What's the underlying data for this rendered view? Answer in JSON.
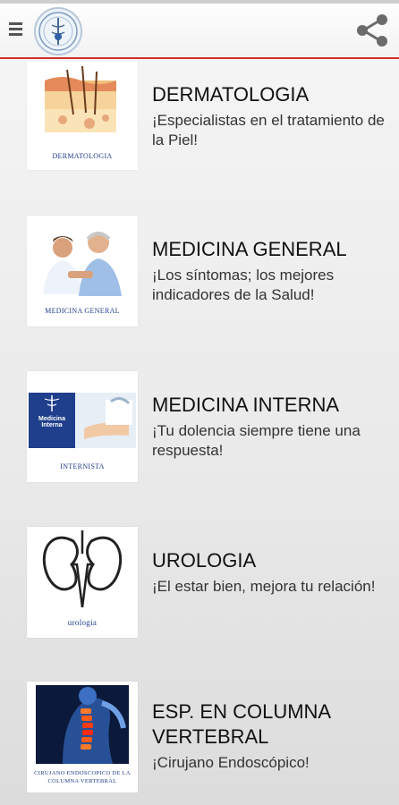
{
  "app": {
    "accent_color": "#d32f2f",
    "menu_icon": "hamburger-icon",
    "logo_icon": "clinic-logo",
    "share_icon": "share-icon"
  },
  "specialties": [
    {
      "title": "DERMATOLOGIA",
      "subtitle": "¡Especialistas en el tratamiento de la Piel!",
      "thumb_caption": "DERMATOLOGIA"
    },
    {
      "title": "MEDICINA GENERAL",
      "subtitle": "¡Los síntomas; los mejores indicadores de la Salud!",
      "thumb_caption": "MEDICINA GENERAL"
    },
    {
      "title": "MEDICINA INTERNA",
      "subtitle": "¡Tu dolencia siempre tiene una respuesta!",
      "thumb_caption": "INTERNISTA",
      "thumb_banner": "Medicina Interna"
    },
    {
      "title": "UROLOGIA",
      "subtitle": "¡El estar bien, mejora tu relación!",
      "thumb_caption": "urologia"
    },
    {
      "title": "ESP. EN COLUMNA VERTEBRAL",
      "subtitle": "¡Cirujano Endoscópico!",
      "thumb_caption": "CIRUJANO ENDOSCOPICO DE LA COLUMNA VERTEBRAL"
    }
  ]
}
